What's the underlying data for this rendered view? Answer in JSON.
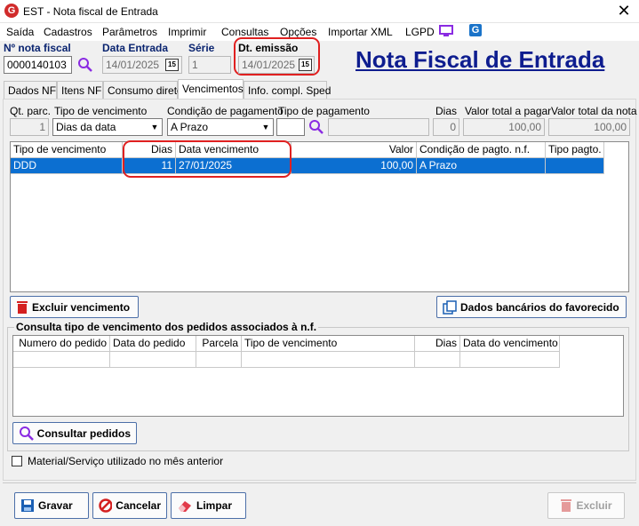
{
  "window": {
    "title": "EST - Nota fiscal de Entrada",
    "close_glyph": "✕"
  },
  "menu": [
    {
      "label": "Saída"
    },
    {
      "label": "Cadastros"
    },
    {
      "label": "Parâmetros"
    },
    {
      "label": "Imprimir"
    },
    {
      "label": "Consultas"
    },
    {
      "label": "Opções"
    },
    {
      "label": "Importar XML"
    },
    {
      "label": "LGPD"
    }
  ],
  "header": {
    "nota_fiscal_label": "Nº nota fiscal",
    "nota_fiscal_value": "0000140103",
    "data_entrada_label": "Data Entrada",
    "data_entrada_value": "14/01/2025",
    "serie_label": "Série",
    "serie_value": "1",
    "dt_emissao_label": "Dt. emissão",
    "dt_emissao_value": "14/01/2025",
    "calendar_glyph": "15",
    "big_title": "Nota Fiscal de Entrada"
  },
  "tabs": [
    {
      "label": "Dados NF"
    },
    {
      "label": "Itens NF"
    },
    {
      "label": "Consumo direto"
    },
    {
      "label": "Vencimentos"
    },
    {
      "label": "Info. compl. Sped"
    }
  ],
  "form": {
    "qt_parc_label": "Qt. parc.",
    "qt_parc_value": "1",
    "tipo_venc_label": "Tipo de vencimento",
    "tipo_venc_value": "Dias da data",
    "cond_pag_label": "Condição de pagamento",
    "cond_pag_value": "A Prazo",
    "tipo_pag_label": "Tipo de pagamento",
    "tipo_pag_value": "",
    "dias_label": "Dias",
    "dias_value": "0",
    "valor_pagar_label": "Valor total a pagar",
    "valor_pagar_value": "100,00",
    "valor_nota_label": "Valor total da nota",
    "valor_nota_value": "100,00"
  },
  "venc_table": {
    "headers": [
      "Tipo de vencimento",
      "Dias",
      "Data vencimento",
      "Valor",
      "Condição de pagto. n.f.",
      "Tipo pagto."
    ],
    "rows": [
      [
        "DDD",
        "11",
        "27/01/2025",
        "100,00",
        "A Prazo",
        ""
      ]
    ]
  },
  "buttons": {
    "excluir_venc": "Excluir vencimento",
    "dados_bancarios": "Dados bancários do favorecido",
    "consultar_pedidos": "Consultar pedidos",
    "gravar": "Gravar",
    "cancelar": "Cancelar",
    "limpar": "Limpar",
    "excluir": "Excluir"
  },
  "consulta": {
    "group_title": "Consulta tipo de vencimento dos pedidos associados à n.f.",
    "headers": [
      "Numero do pedido",
      "Data do pedido",
      "Parcela",
      "Tipo de vencimento",
      "Dias",
      "Data do vencimento"
    ]
  },
  "checkbox": {
    "label": "Material/Serviço utilizado no mês anterior",
    "checked": false
  },
  "colors": {
    "selection": "#0c6fd1",
    "title_blue": "#0e1d8f",
    "highlight_red": "#e02020"
  }
}
